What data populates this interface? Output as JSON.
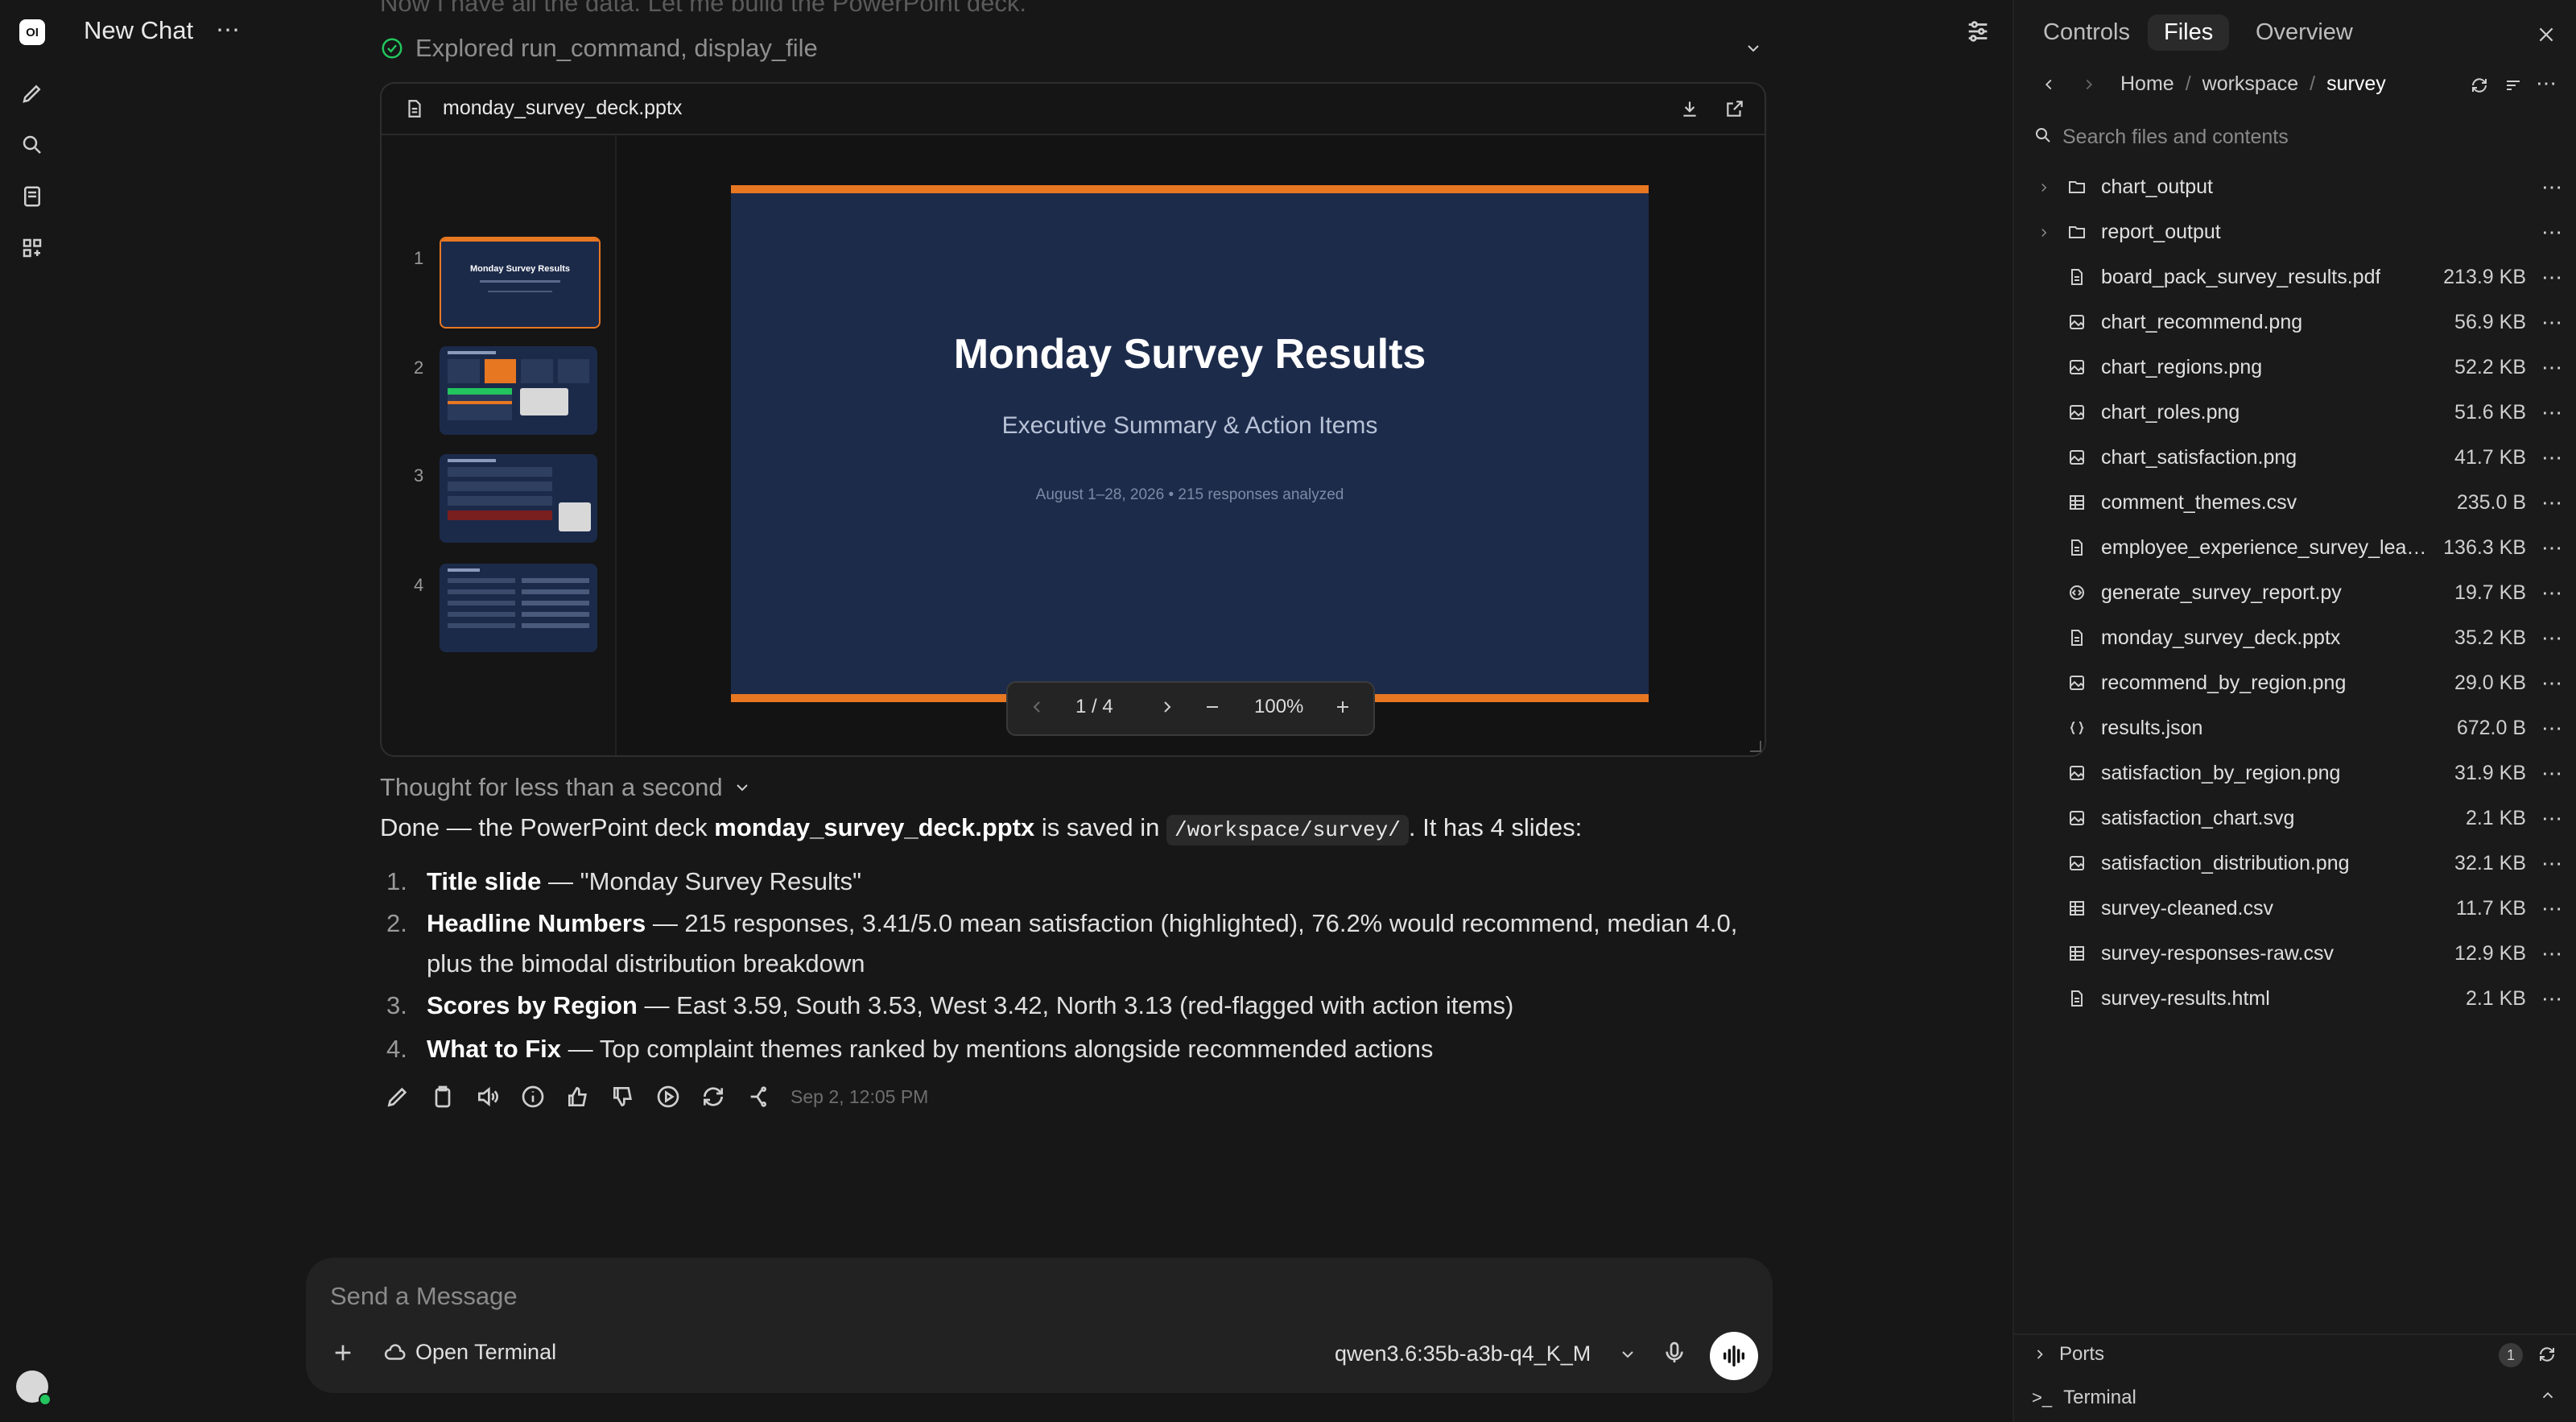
{
  "app": {
    "chat_title": "New Chat"
  },
  "message": {
    "prev_text": "Now I have all the data. Let me build the PowerPoint deck.",
    "explored": "Explored run_command, display_file",
    "file_card": {
      "filename": "monday_survey_deck.pptx",
      "thumb_numbers": [
        "1",
        "2",
        "3",
        "4"
      ],
      "slide": {
        "title": "Monday Survey Results",
        "subtitle": "Executive Summary & Action Items",
        "meta": "August 1–28, 2026  •  215 responses analyzed",
        "accent": "#e87722",
        "bg": "#1d2b4b"
      },
      "controls": {
        "page": "1 / 4",
        "zoom": "100%"
      }
    },
    "thought": "Thought for less than a second",
    "done": {
      "p1": "Done — the PowerPoint deck ",
      "file": "monday_survey_deck.pptx",
      "p2": " is saved in ",
      "path": "/workspace/survey/",
      "p3": ". It has 4 slides:"
    },
    "list": [
      {
        "n": "1.",
        "b": "Title slide",
        "t": " — \"Monday Survey Results\""
      },
      {
        "n": "2.",
        "b": "Headline Numbers",
        "t": " — 215 responses, 3.41/5.0 mean satisfaction (highlighted), 76.2% would recommend, median 4.0,"
      },
      {
        "n": "",
        "b": "",
        "t": "plus the bimodal distribution breakdown"
      },
      {
        "n": "3.",
        "b": "Scores by Region",
        "t": " — East 3.59, South 3.53, West 3.42, North 3.13 (red-flagged with action items)"
      },
      {
        "n": "4.",
        "b": "What to Fix",
        "t": " — Top complaint themes ranked by mentions alongside recommended actions"
      }
    ],
    "timestamp": "Sep 2, 12:05 PM"
  },
  "composer": {
    "placeholder": "Send a Message",
    "terminal_label": "Open Terminal",
    "model": "qwen3.6:35b-a3b-q4_K_M"
  },
  "panel": {
    "tabs": [
      "Controls",
      "Files",
      "Overview"
    ],
    "breadcrumb": [
      "Home",
      "/",
      "workspace",
      "/",
      "survey"
    ],
    "search_placeholder": "Search files and contents",
    "files": [
      {
        "name": "chart_output",
        "size": "",
        "kind": "folder"
      },
      {
        "name": "report_output",
        "size": "",
        "kind": "folder"
      },
      {
        "name": "board_pack_survey_results.pdf",
        "size": "213.9 KB",
        "kind": "doc"
      },
      {
        "name": "chart_recommend.png",
        "size": "56.9 KB",
        "kind": "image"
      },
      {
        "name": "chart_regions.png",
        "size": "52.2 KB",
        "kind": "image"
      },
      {
        "name": "chart_roles.png",
        "size": "51.6 KB",
        "kind": "image"
      },
      {
        "name": "chart_satisfaction.png",
        "size": "41.7 KB",
        "kind": "image"
      },
      {
        "name": "comment_themes.csv",
        "size": "235.0 B",
        "kind": "table"
      },
      {
        "name": "employee_experience_survey_lead...",
        "size": "136.3 KB",
        "kind": "doc"
      },
      {
        "name": "generate_survey_report.py",
        "size": "19.7 KB",
        "kind": "code"
      },
      {
        "name": "monday_survey_deck.pptx",
        "size": "35.2 KB",
        "kind": "doc"
      },
      {
        "name": "recommend_by_region.png",
        "size": "29.0 KB",
        "kind": "image"
      },
      {
        "name": "results.json",
        "size": "672.0 B",
        "kind": "json"
      },
      {
        "name": "satisfaction_by_region.png",
        "size": "31.9 KB",
        "kind": "image"
      },
      {
        "name": "satisfaction_chart.svg",
        "size": "2.1 KB",
        "kind": "image"
      },
      {
        "name": "satisfaction_distribution.png",
        "size": "32.1 KB",
        "kind": "image"
      },
      {
        "name": "survey-cleaned.csv",
        "size": "11.7 KB",
        "kind": "table"
      },
      {
        "name": "survey-responses-raw.csv",
        "size": "12.9 KB",
        "kind": "table"
      },
      {
        "name": "survey-results.html",
        "size": "2.1 KB",
        "kind": "doc"
      }
    ],
    "ports_label": "Ports",
    "ports_count": "1",
    "terminal_label": "Terminal"
  }
}
